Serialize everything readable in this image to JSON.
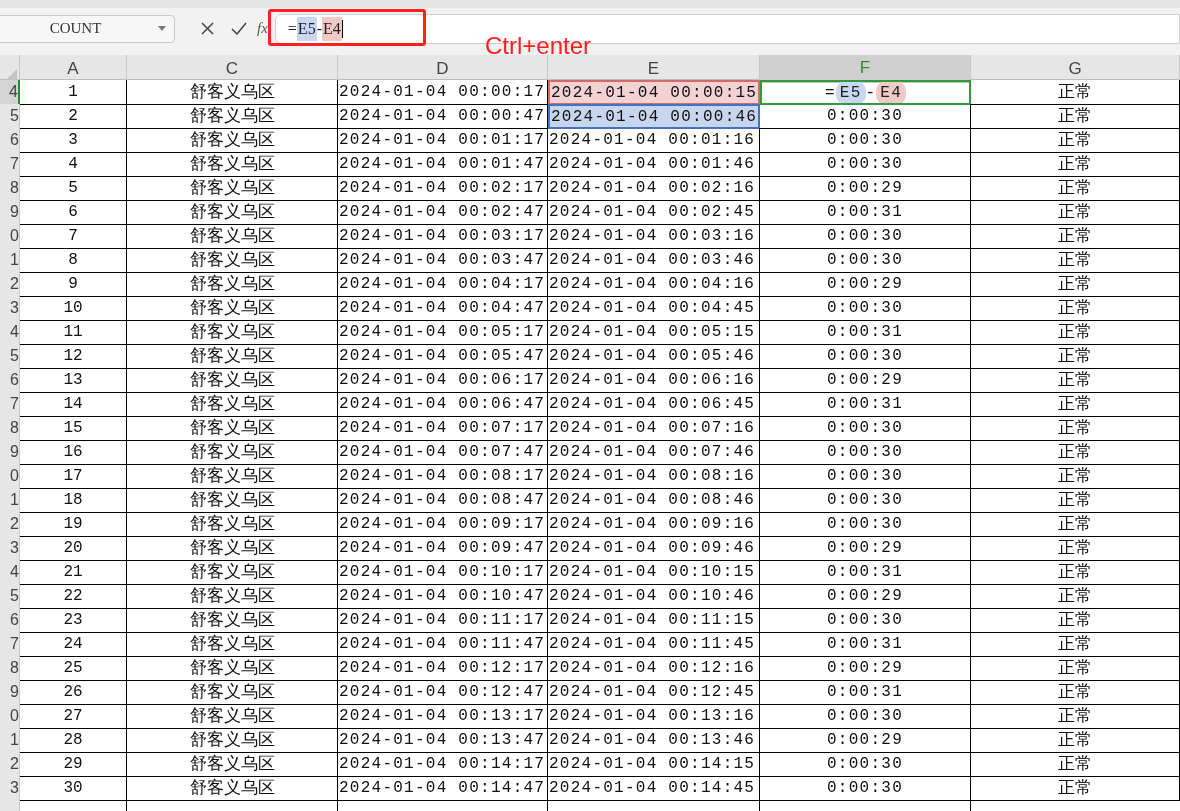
{
  "name_box": {
    "value": "COUNT"
  },
  "formula_bar": {
    "fx_label": "fx",
    "formula": [
      {
        "kind": "text",
        "text": "="
      },
      {
        "kind": "ref",
        "text": "E5",
        "color": "#c9d7f2"
      },
      {
        "kind": "text",
        "text": "-"
      },
      {
        "kind": "ref",
        "text": "E4",
        "color": "#f1c9c9"
      }
    ]
  },
  "annotation": {
    "text": "Ctrl+enter"
  },
  "table": {
    "columns": [
      {
        "label": "A",
        "kind": "number",
        "selected": false
      },
      {
        "label": "C",
        "kind": "cjk",
        "selected": false
      },
      {
        "label": "D",
        "kind": "mono",
        "selected": false
      },
      {
        "label": "E",
        "kind": "mono",
        "selected": false
      },
      {
        "label": "F",
        "kind": "mono",
        "selected": true
      },
      {
        "label": "G",
        "kind": "cjk",
        "selected": false
      }
    ],
    "rows": [
      {
        "header": "4",
        "selected": true,
        "cells": [
          {
            "text": "1"
          },
          {
            "text": "舒客义乌区"
          },
          {
            "text": "2024-01-04 00:00:17"
          },
          {
            "text": "2024-01-04 00:00:15",
            "color": "#d46a6a"
          },
          {
            "formula": [
              {
                "kind": "text",
                "text": "="
              },
              {
                "kind": "ref",
                "text": "E5",
                "color": "#c9d7f2"
              },
              {
                "kind": "text",
                "text": "-"
              },
              {
                "kind": "ref",
                "text": "E4",
                "color": "#f1c9c9"
              }
            ]
          },
          {
            "text": "正常"
          }
        ]
      },
      {
        "header": "5",
        "selected": false,
        "cells": [
          {
            "text": "2"
          },
          {
            "text": "舒客义乌区"
          },
          {
            "text": "2024-01-04 00:00:47"
          },
          {
            "text": "2024-01-04 00:00:46",
            "color": "#4472c4"
          },
          {
            "text": "0:00:30"
          },
          {
            "text": "正常"
          }
        ]
      },
      {
        "header": "6",
        "selected": false,
        "cells": [
          {
            "text": "3"
          },
          {
            "text": "舒客义乌区"
          },
          {
            "text": "2024-01-04 00:01:17"
          },
          {
            "text": "2024-01-04 00:01:16"
          },
          {
            "text": "0:00:30"
          },
          {
            "text": "正常"
          }
        ]
      },
      {
        "header": "7",
        "selected": false,
        "cells": [
          {
            "text": "4"
          },
          {
            "text": "舒客义乌区"
          },
          {
            "text": "2024-01-04 00:01:47"
          },
          {
            "text": "2024-01-04 00:01:46"
          },
          {
            "text": "0:00:30"
          },
          {
            "text": "正常"
          }
        ]
      },
      {
        "header": "8",
        "selected": false,
        "cells": [
          {
            "text": "5"
          },
          {
            "text": "舒客义乌区"
          },
          {
            "text": "2024-01-04 00:02:17"
          },
          {
            "text": "2024-01-04 00:02:16"
          },
          {
            "text": "0:00:29"
          },
          {
            "text": "正常"
          }
        ]
      },
      {
        "header": "9",
        "selected": false,
        "cells": [
          {
            "text": "6"
          },
          {
            "text": "舒客义乌区"
          },
          {
            "text": "2024-01-04 00:02:47"
          },
          {
            "text": "2024-01-04 00:02:45"
          },
          {
            "text": "0:00:31"
          },
          {
            "text": "正常"
          }
        ]
      },
      {
        "header": "0",
        "selected": false,
        "cells": [
          {
            "text": "7"
          },
          {
            "text": "舒客义乌区"
          },
          {
            "text": "2024-01-04 00:03:17"
          },
          {
            "text": "2024-01-04 00:03:16"
          },
          {
            "text": "0:00:30"
          },
          {
            "text": "正常"
          }
        ]
      },
      {
        "header": "1",
        "selected": false,
        "cells": [
          {
            "text": "8"
          },
          {
            "text": "舒客义乌区"
          },
          {
            "text": "2024-01-04 00:03:47"
          },
          {
            "text": "2024-01-04 00:03:46"
          },
          {
            "text": "0:00:30"
          },
          {
            "text": "正常"
          }
        ]
      },
      {
        "header": "2",
        "selected": false,
        "cells": [
          {
            "text": "9"
          },
          {
            "text": "舒客义乌区"
          },
          {
            "text": "2024-01-04 00:04:17"
          },
          {
            "text": "2024-01-04 00:04:16"
          },
          {
            "text": "0:00:29"
          },
          {
            "text": "正常"
          }
        ]
      },
      {
        "header": "3",
        "selected": false,
        "cells": [
          {
            "text": "10"
          },
          {
            "text": "舒客义乌区"
          },
          {
            "text": "2024-01-04 00:04:47"
          },
          {
            "text": "2024-01-04 00:04:45"
          },
          {
            "text": "0:00:30"
          },
          {
            "text": "正常"
          }
        ]
      },
      {
        "header": "4",
        "selected": false,
        "cells": [
          {
            "text": "11"
          },
          {
            "text": "舒客义乌区"
          },
          {
            "text": "2024-01-04 00:05:17"
          },
          {
            "text": "2024-01-04 00:05:15"
          },
          {
            "text": "0:00:31"
          },
          {
            "text": "正常"
          }
        ]
      },
      {
        "header": "5",
        "selected": false,
        "cells": [
          {
            "text": "12"
          },
          {
            "text": "舒客义乌区"
          },
          {
            "text": "2024-01-04 00:05:47"
          },
          {
            "text": "2024-01-04 00:05:46"
          },
          {
            "text": "0:00:30"
          },
          {
            "text": "正常"
          }
        ]
      },
      {
        "header": "6",
        "selected": false,
        "cells": [
          {
            "text": "13"
          },
          {
            "text": "舒客义乌区"
          },
          {
            "text": "2024-01-04 00:06:17"
          },
          {
            "text": "2024-01-04 00:06:16"
          },
          {
            "text": "0:00:29"
          },
          {
            "text": "正常"
          }
        ]
      },
      {
        "header": "7",
        "selected": false,
        "cells": [
          {
            "text": "14"
          },
          {
            "text": "舒客义乌区"
          },
          {
            "text": "2024-01-04 00:06:47"
          },
          {
            "text": "2024-01-04 00:06:45"
          },
          {
            "text": "0:00:31"
          },
          {
            "text": "正常"
          }
        ]
      },
      {
        "header": "8",
        "selected": false,
        "cells": [
          {
            "text": "15"
          },
          {
            "text": "舒客义乌区"
          },
          {
            "text": "2024-01-04 00:07:17"
          },
          {
            "text": "2024-01-04 00:07:16"
          },
          {
            "text": "0:00:30"
          },
          {
            "text": "正常"
          }
        ]
      },
      {
        "header": "9",
        "selected": false,
        "cells": [
          {
            "text": "16"
          },
          {
            "text": "舒客义乌区"
          },
          {
            "text": "2024-01-04 00:07:47"
          },
          {
            "text": "2024-01-04 00:07:46"
          },
          {
            "text": "0:00:30"
          },
          {
            "text": "正常"
          }
        ]
      },
      {
        "header": "0",
        "selected": false,
        "cells": [
          {
            "text": "17"
          },
          {
            "text": "舒客义乌区"
          },
          {
            "text": "2024-01-04 00:08:17"
          },
          {
            "text": "2024-01-04 00:08:16"
          },
          {
            "text": "0:00:30"
          },
          {
            "text": "正常"
          }
        ]
      },
      {
        "header": "1",
        "selected": false,
        "cells": [
          {
            "text": "18"
          },
          {
            "text": "舒客义乌区"
          },
          {
            "text": "2024-01-04 00:08:47"
          },
          {
            "text": "2024-01-04 00:08:46"
          },
          {
            "text": "0:00:30"
          },
          {
            "text": "正常"
          }
        ]
      },
      {
        "header": "2",
        "selected": false,
        "cells": [
          {
            "text": "19"
          },
          {
            "text": "舒客义乌区"
          },
          {
            "text": "2024-01-04 00:09:17"
          },
          {
            "text": "2024-01-04 00:09:16"
          },
          {
            "text": "0:00:30"
          },
          {
            "text": "正常"
          }
        ]
      },
      {
        "header": "3",
        "selected": false,
        "cells": [
          {
            "text": "20"
          },
          {
            "text": "舒客义乌区"
          },
          {
            "text": "2024-01-04 00:09:47"
          },
          {
            "text": "2024-01-04 00:09:46"
          },
          {
            "text": "0:00:29"
          },
          {
            "text": "正常"
          }
        ]
      },
      {
        "header": "4",
        "selected": false,
        "cells": [
          {
            "text": "21"
          },
          {
            "text": "舒客义乌区"
          },
          {
            "text": "2024-01-04 00:10:17"
          },
          {
            "text": "2024-01-04 00:10:15"
          },
          {
            "text": "0:00:31"
          },
          {
            "text": "正常"
          }
        ]
      },
      {
        "header": "5",
        "selected": false,
        "cells": [
          {
            "text": "22"
          },
          {
            "text": "舒客义乌区"
          },
          {
            "text": "2024-01-04 00:10:47"
          },
          {
            "text": "2024-01-04 00:10:46"
          },
          {
            "text": "0:00:29"
          },
          {
            "text": "正常"
          }
        ]
      },
      {
        "header": "6",
        "selected": false,
        "cells": [
          {
            "text": "23"
          },
          {
            "text": "舒客义乌区"
          },
          {
            "text": "2024-01-04 00:11:17"
          },
          {
            "text": "2024-01-04 00:11:15"
          },
          {
            "text": "0:00:30"
          },
          {
            "text": "正常"
          }
        ]
      },
      {
        "header": "7",
        "selected": false,
        "cells": [
          {
            "text": "24"
          },
          {
            "text": "舒客义乌区"
          },
          {
            "text": "2024-01-04 00:11:47"
          },
          {
            "text": "2024-01-04 00:11:45"
          },
          {
            "text": "0:00:31"
          },
          {
            "text": "正常"
          }
        ]
      },
      {
        "header": "8",
        "selected": false,
        "cells": [
          {
            "text": "25"
          },
          {
            "text": "舒客义乌区"
          },
          {
            "text": "2024-01-04 00:12:17"
          },
          {
            "text": "2024-01-04 00:12:16"
          },
          {
            "text": "0:00:29"
          },
          {
            "text": "正常"
          }
        ]
      },
      {
        "header": "9",
        "selected": false,
        "cells": [
          {
            "text": "26"
          },
          {
            "text": "舒客义乌区"
          },
          {
            "text": "2024-01-04 00:12:47"
          },
          {
            "text": "2024-01-04 00:12:45"
          },
          {
            "text": "0:00:31"
          },
          {
            "text": "正常"
          }
        ]
      },
      {
        "header": "0",
        "selected": false,
        "cells": [
          {
            "text": "27"
          },
          {
            "text": "舒客义乌区"
          },
          {
            "text": "2024-01-04 00:13:17"
          },
          {
            "text": "2024-01-04 00:13:16"
          },
          {
            "text": "0:00:30"
          },
          {
            "text": "正常"
          }
        ]
      },
      {
        "header": "1",
        "selected": false,
        "cells": [
          {
            "text": "28"
          },
          {
            "text": "舒客义乌区"
          },
          {
            "text": "2024-01-04 00:13:47"
          },
          {
            "text": "2024-01-04 00:13:46"
          },
          {
            "text": "0:00:29"
          },
          {
            "text": "正常"
          }
        ]
      },
      {
        "header": "2",
        "selected": false,
        "cells": [
          {
            "text": "29"
          },
          {
            "text": "舒客义乌区"
          },
          {
            "text": "2024-01-04 00:14:17"
          },
          {
            "text": "2024-01-04 00:14:15"
          },
          {
            "text": "0:00:30"
          },
          {
            "text": "正常"
          }
        ]
      },
      {
        "header": "3",
        "selected": false,
        "cells": [
          {
            "text": "30"
          },
          {
            "text": "舒客义乌区"
          },
          {
            "text": "2024-01-04 00:14:47"
          },
          {
            "text": "2024-01-04 00:14:45"
          },
          {
            "text": "0:00:30"
          },
          {
            "text": "正常"
          }
        ]
      }
    ]
  }
}
